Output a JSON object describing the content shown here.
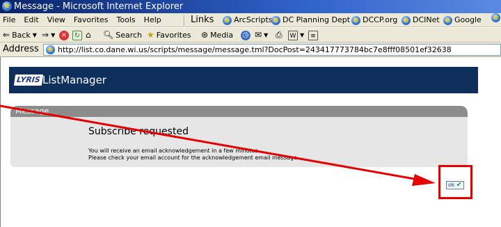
{
  "window": {
    "title": "Message - Microsoft Internet Explorer"
  },
  "menubar": {
    "items": [
      "File",
      "Edit",
      "View",
      "Favorites",
      "Tools",
      "Help"
    ],
    "links_label": "Links",
    "links": [
      "ArcScripts",
      "DC Planning Dept",
      "DCCP.org",
      "DCINet",
      "Google"
    ]
  },
  "toolbar": {
    "back": "Back",
    "search": "Search",
    "favorites": "Favorites",
    "media": "Media"
  },
  "address": {
    "label": "Address",
    "url": "http://list.co.dane.wi.us/scripts/message/message.tml?DocPost=243417773784bc7e8fff08501ef32638"
  },
  "page": {
    "logo": "LYRIS",
    "app_title": "ListManager",
    "message_header": "Message",
    "message_heading": "Subscribe requested",
    "message_line1": "You will receive an email acknowledgement in a few minutes.",
    "message_line2": "Please check your email account for the acknowledgement email message.",
    "ok_label": "ok",
    "ok_check": "✔"
  },
  "annotation": {
    "color": "#e60000"
  }
}
